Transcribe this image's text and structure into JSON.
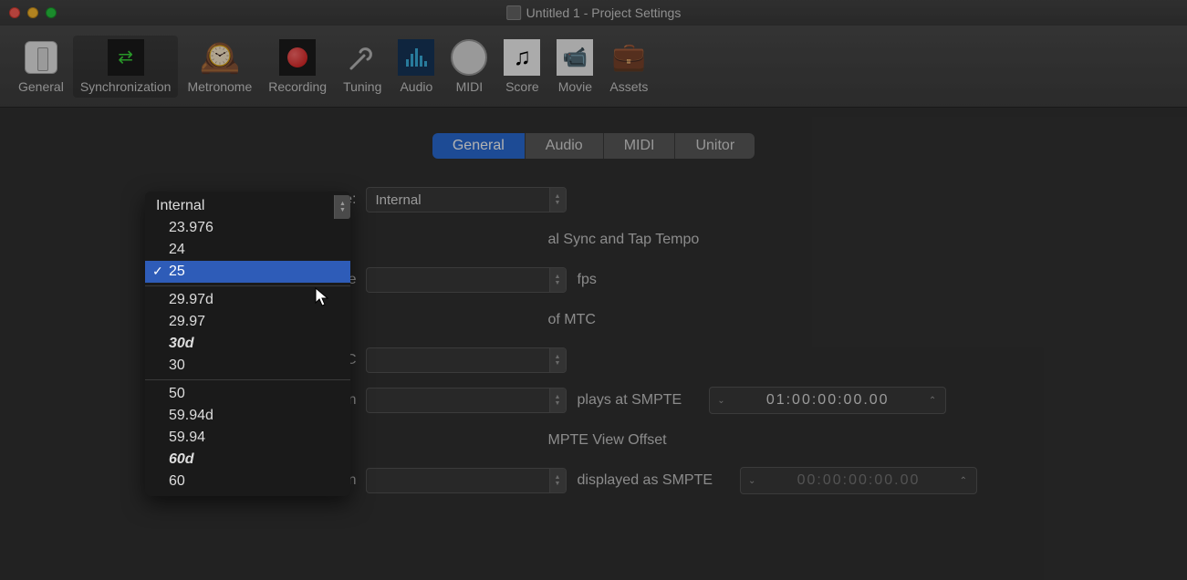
{
  "window": {
    "title": "Untitled 1 - Project Settings"
  },
  "toolbar": {
    "items": [
      {
        "label": "General"
      },
      {
        "label": "Synchronization"
      },
      {
        "label": "Metronome"
      },
      {
        "label": "Recording"
      },
      {
        "label": "Tuning"
      },
      {
        "label": "Audio"
      },
      {
        "label": "MIDI"
      },
      {
        "label": "Score"
      },
      {
        "label": "Movie"
      },
      {
        "label": "Assets"
      }
    ],
    "active": "Synchronization"
  },
  "tabs": {
    "items": [
      "General",
      "Audio",
      "MIDI",
      "Unitor"
    ],
    "active": "General"
  },
  "form": {
    "sync_mode": {
      "label": "Sync Mode:",
      "value": "Internal"
    },
    "auto_enable_label": "al Sync and Tap Tempo",
    "frame_rate": {
      "label": "Frame Rate",
      "unit": "fps"
    },
    "auto_detect_label": "of MTC",
    "validate_mtc": {
      "label": "Validate MTC"
    },
    "bar_position_1": {
      "label": "Bar Position",
      "middle": "plays at SMPTE",
      "value": "01:00:00:00.00"
    },
    "smpte_offset_label": "MPTE View Offset",
    "bar_position_2": {
      "label": "Bar Position",
      "middle": "displayed as SMPTE",
      "value": "00:00:00:00.00"
    }
  },
  "frame_rate_menu": {
    "selected": "25",
    "groups": [
      [
        "23.976",
        "24",
        "25"
      ],
      [
        "29.97d",
        "29.97",
        "30d",
        "30"
      ],
      [
        "50",
        "59.94d",
        "59.94",
        "60d",
        "60"
      ]
    ],
    "italic_items": [
      "30d",
      "60d"
    ]
  }
}
